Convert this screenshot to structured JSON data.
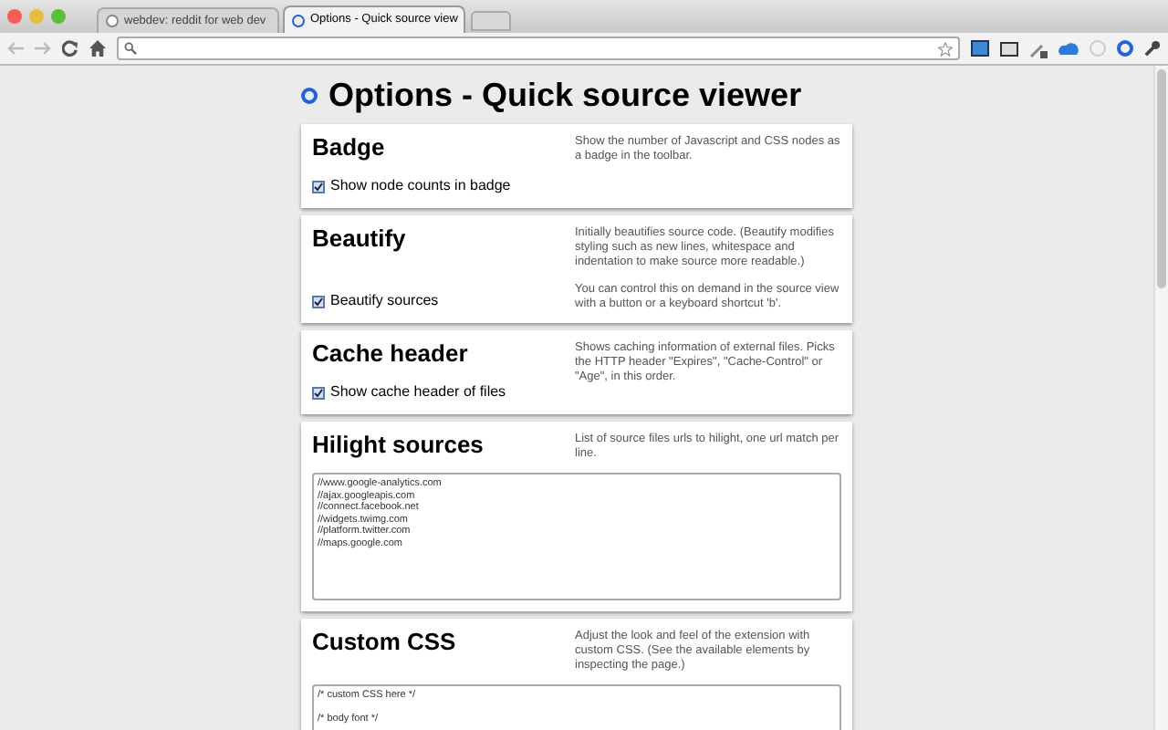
{
  "tabs": [
    {
      "title": "webdev: reddit for web dev",
      "selected": false
    },
    {
      "title": "Options - Quick source view",
      "selected": true
    }
  ],
  "page_title": "Options - Quick source viewer",
  "sections": [
    {
      "kind": "checkbox",
      "heading": "Badge",
      "option": {
        "label": "Show node counts in badge",
        "checked": true
      },
      "description": [
        "Show the number of Javascript and CSS nodes as a badge in the toolbar."
      ]
    },
    {
      "kind": "checkbox",
      "heading": "Beautify",
      "option": {
        "label": "Beautify sources",
        "checked": true
      },
      "description": [
        "Initially beautifies source code. (Beautify modifies styling such as new lines, whitespace and indentation to make source more readable.)",
        "You can control this on demand in the source view with a button or a keyboard shortcut 'b'."
      ]
    },
    {
      "kind": "checkbox",
      "heading": "Cache header",
      "option": {
        "label": "Show cache header of files",
        "checked": true
      },
      "description": [
        "Shows caching information of external files. Picks the HTTP header \"Expires\", \"Cache-Control\" or \"Age\", in this order."
      ]
    },
    {
      "kind": "textarea",
      "heading": "Hilight sources",
      "lines": [
        "//www.google-analytics.com",
        "//ajax.googleapis.com",
        "//connect.facebook.net",
        "//widgets.twimg.com",
        "//platform.twitter.com",
        "//maps.google.com"
      ],
      "description": [
        "List of source files urls to hilight, one url match per line."
      ]
    },
    {
      "kind": "textarea",
      "heading": "Custom CSS",
      "lines": [
        "/* custom CSS here */\n\n/* body font */"
      ],
      "description": [
        "Adjust the look and feel of the extension with custom CSS. (See the available elements by inspecting the page.)"
      ]
    }
  ]
}
